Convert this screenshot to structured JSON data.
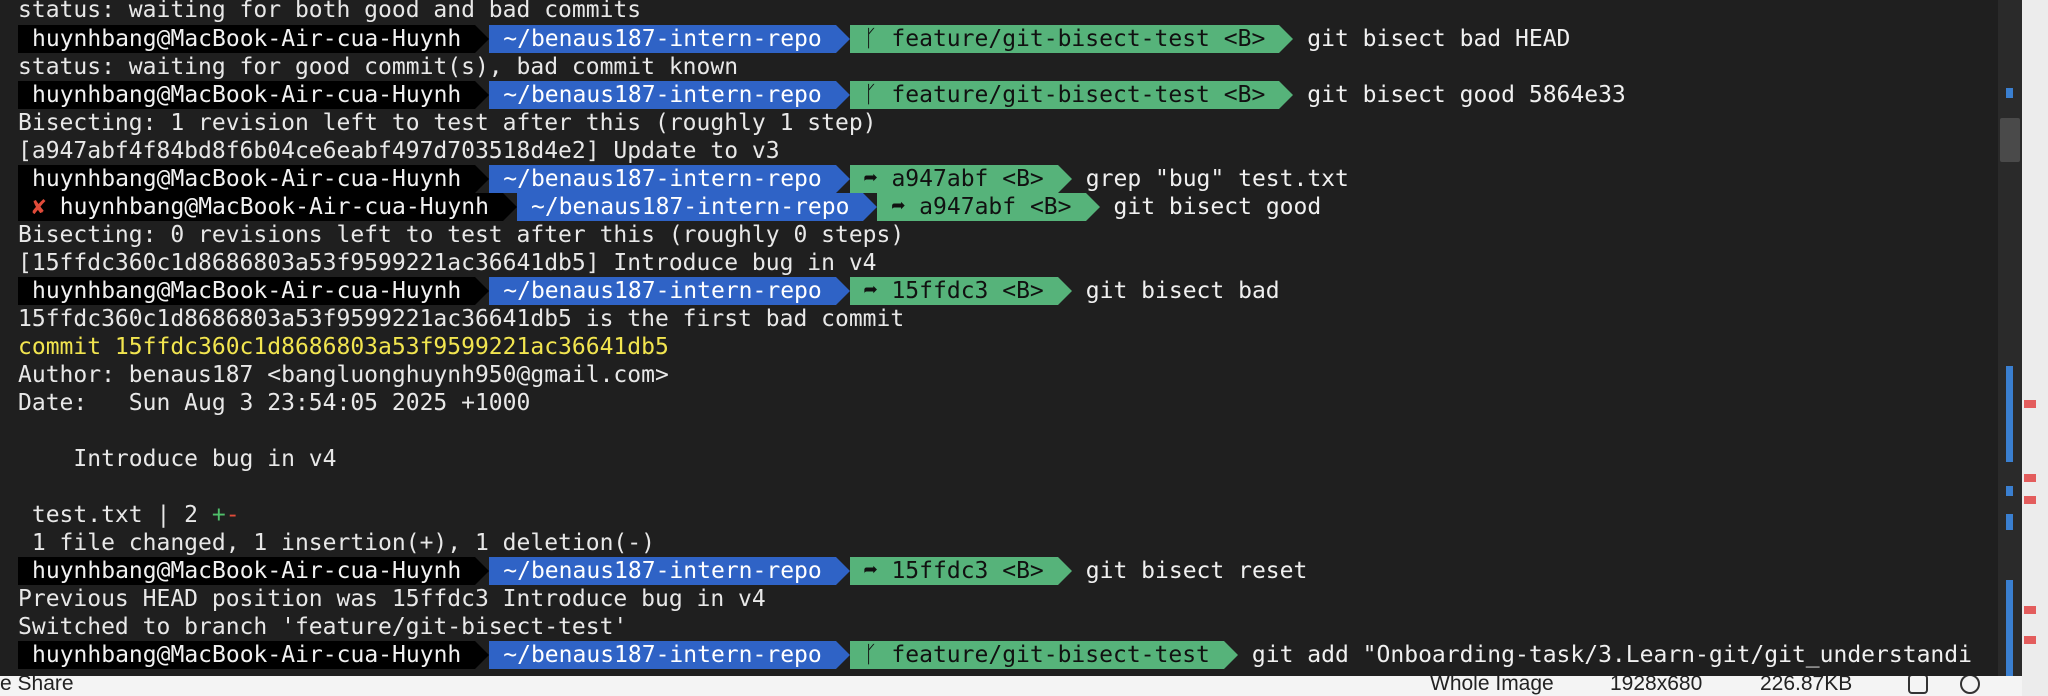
{
  "prompt": {
    "user": "huynhbang@MacBook-Air-cua-Huynh",
    "dir": "~/benaus187-intern-repo",
    "fail_mark": "✘"
  },
  "lines": {
    "l0": "status: waiting for both good and bad commits",
    "p1_git": "ᚴ feature/git-bisect-test <B>",
    "p1_cmd": "git bisect bad HEAD",
    "l2": "status: waiting for good commit(s), bad commit known",
    "p3_git": "ᚴ feature/git-bisect-test <B>",
    "p3_cmd": "git bisect good 5864e33",
    "l4": "Bisecting: 1 revision left to test after this (roughly 1 step)",
    "l5": "[a947abf4f84bd8f6b04ce6eabf497d703518d4e2] Update to v3",
    "p6_git": "➦ a947abf <B>",
    "p6_cmd": "grep \"bug\" test.txt",
    "p7_git": "➦ a947abf <B>",
    "p7_cmd": "git bisect good",
    "l8": "Bisecting: 0 revisions left to test after this (roughly 0 steps)",
    "l9": "[15ffdc360c1d8686803a53f9599221ac36641db5] Introduce bug in v4",
    "p10_git": "➦ 15ffdc3 <B>",
    "p10_cmd": "git bisect bad",
    "l11": "15ffdc360c1d8686803a53f9599221ac36641db5 is the first bad commit",
    "l12": "commit 15ffdc360c1d8686803a53f9599221ac36641db5",
    "l13": "Author: benaus187 <bangluonghuynh950@gmail.com>",
    "l14": "Date:   Sun Aug 3 23:54:05 2025 +1000",
    "l16": "    Introduce bug in v4",
    "l18_file": " test.txt | 2 ",
    "l18_plus": "+",
    "l18_minus": "-",
    "l19": " 1 file changed, 1 insertion(+), 1 deletion(-)",
    "p20_git": "➦ 15ffdc3 <B>",
    "p20_cmd": "git bisect reset",
    "l21": "Previous HEAD position was 15ffdc3 Introduce bug in v4",
    "l22": "Switched to branch 'feature/git-bisect-test'",
    "p23_git": "ᚴ feature/git-bisect-test",
    "p23_cmd": "git add \"Onboarding-task/3.Learn-git/git_understandi"
  },
  "statusbar": {
    "share": "e Share",
    "view": "Whole Image",
    "dims": "1928x680",
    "size": "226.87KB"
  },
  "colors": {
    "background": "#1f1f1f",
    "user_segment": "#000000",
    "dir_segment": "#2f63c6",
    "git_segment": "#56b37a",
    "commit_hash": "#f2e54f",
    "error": "#e04b3a"
  }
}
